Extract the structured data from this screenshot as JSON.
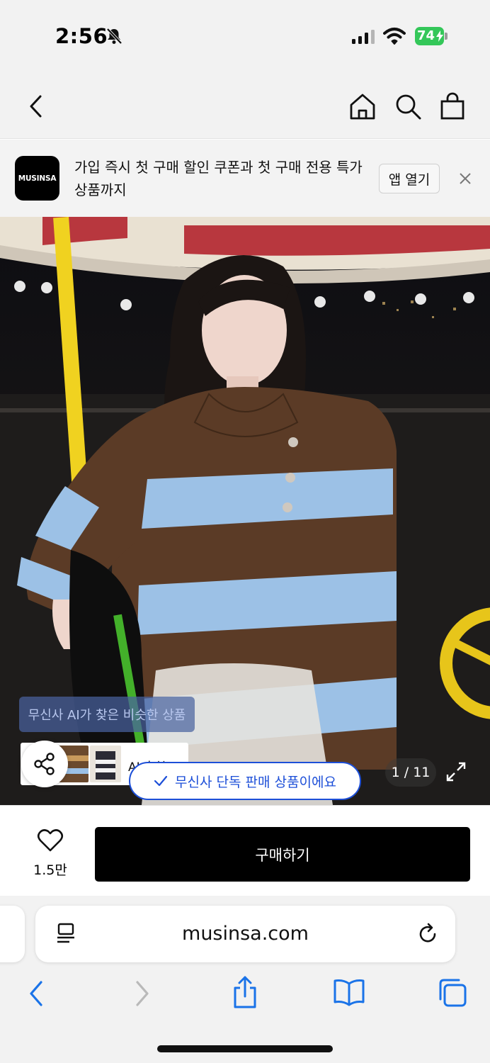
{
  "status_bar": {
    "time": "2:56",
    "battery": "74",
    "icons": [
      "bell-slash-icon",
      "cellular-signal-icon",
      "wifi-icon",
      "battery-charging-icon"
    ]
  },
  "header": {
    "icons": [
      "back-chevron-icon",
      "home-icon",
      "search-icon",
      "shopping-bag-icon"
    ]
  },
  "banner": {
    "logo_text": "MUSINSA",
    "message": "가입 즉시 첫 구매 할인 쿠폰과 첫 구매 전용 특가 상품까지",
    "open_app_label": "앱 열기"
  },
  "product_image": {
    "ai_tooltip": "무신사 AI가 찾은 비슷한 상품",
    "ai_label": "AI 추천",
    "exclusive_badge": "무신사 단독 판매 상품이에요",
    "counter": "1 / 11"
  },
  "buy_bar": {
    "like_count": "1.5만",
    "buy_label": "구매하기"
  },
  "safari": {
    "url": "musinsa.com"
  },
  "colors": {
    "accent_blue": "#1d4fd8",
    "battery_green": "#34c759",
    "ios_blue": "#1a73e8"
  }
}
